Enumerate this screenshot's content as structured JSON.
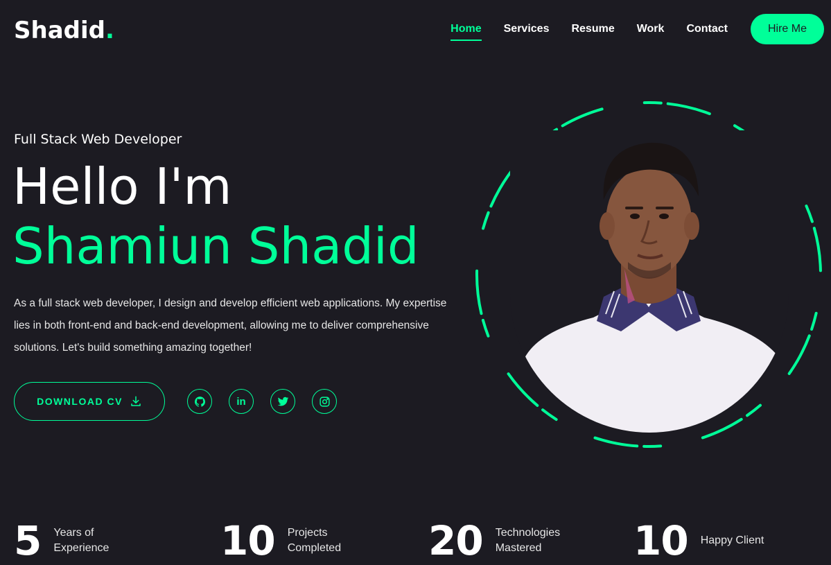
{
  "brand": {
    "name": "Shadid",
    "dot": ".",
    "accent": "#00ff99",
    "background": "#1c1b22"
  },
  "nav": {
    "items": [
      {
        "label": "Home",
        "active": true
      },
      {
        "label": "Services"
      },
      {
        "label": "Resume"
      },
      {
        "label": "Work"
      },
      {
        "label": "Contact"
      }
    ],
    "hire_label": "Hire Me"
  },
  "hero": {
    "subtitle": "Full Stack Web Developer",
    "greeting": "Hello I'm",
    "name": "Shamiun Shadid",
    "description": "As a full stack web developer, I design and develop efficient web applications. My expertise lies in both front-end and back-end development, allowing me to deliver comprehensive solutions. Let's build something amazing together!",
    "cv_label": "DOWNLOAD CV",
    "cv_icon": "download-icon",
    "socials": [
      {
        "name": "github",
        "icon": "github-icon"
      },
      {
        "name": "linkedin",
        "icon": "linkedin-icon",
        "glyph": "in"
      },
      {
        "name": "twitter",
        "icon": "twitter-icon"
      },
      {
        "name": "instagram",
        "icon": "instagram-icon"
      }
    ]
  },
  "stats": [
    {
      "number": "5",
      "label": "Years of\nExperience"
    },
    {
      "number": "10",
      "label": "Projects\nCompleted"
    },
    {
      "number": "20",
      "label": "Technologies\nMastered"
    },
    {
      "number": "10",
      "label": "Happy Client"
    }
  ]
}
